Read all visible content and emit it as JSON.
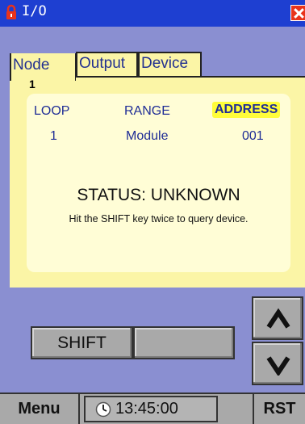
{
  "window": {
    "title": "I/O"
  },
  "tabs": [
    {
      "label": "Node"
    },
    {
      "label": "Output"
    },
    {
      "label": "Device"
    }
  ],
  "node_number": "1",
  "columns": {
    "loop": {
      "header": "LOOP",
      "value": "1"
    },
    "range": {
      "header": "RANGE",
      "value": "Module"
    },
    "address": {
      "header": "ADDRESS",
      "value": "001"
    }
  },
  "status": {
    "text": "STATUS: UNKNOWN",
    "hint": "Hit the SHIFT key twice to query device."
  },
  "buttons": {
    "shift": "SHIFT",
    "up_icon": "chevron-up-icon",
    "down_icon": "chevron-down-icon"
  },
  "taskbar": {
    "menu": "Menu",
    "clock": "13:45:00",
    "rst": "RST"
  },
  "colors": {
    "titlebar": "#1e3fd1",
    "background": "#8a8fd1",
    "panel": "#fbf5a6",
    "highlight": "#fffd3a",
    "text_accent": "#1f2d96"
  }
}
